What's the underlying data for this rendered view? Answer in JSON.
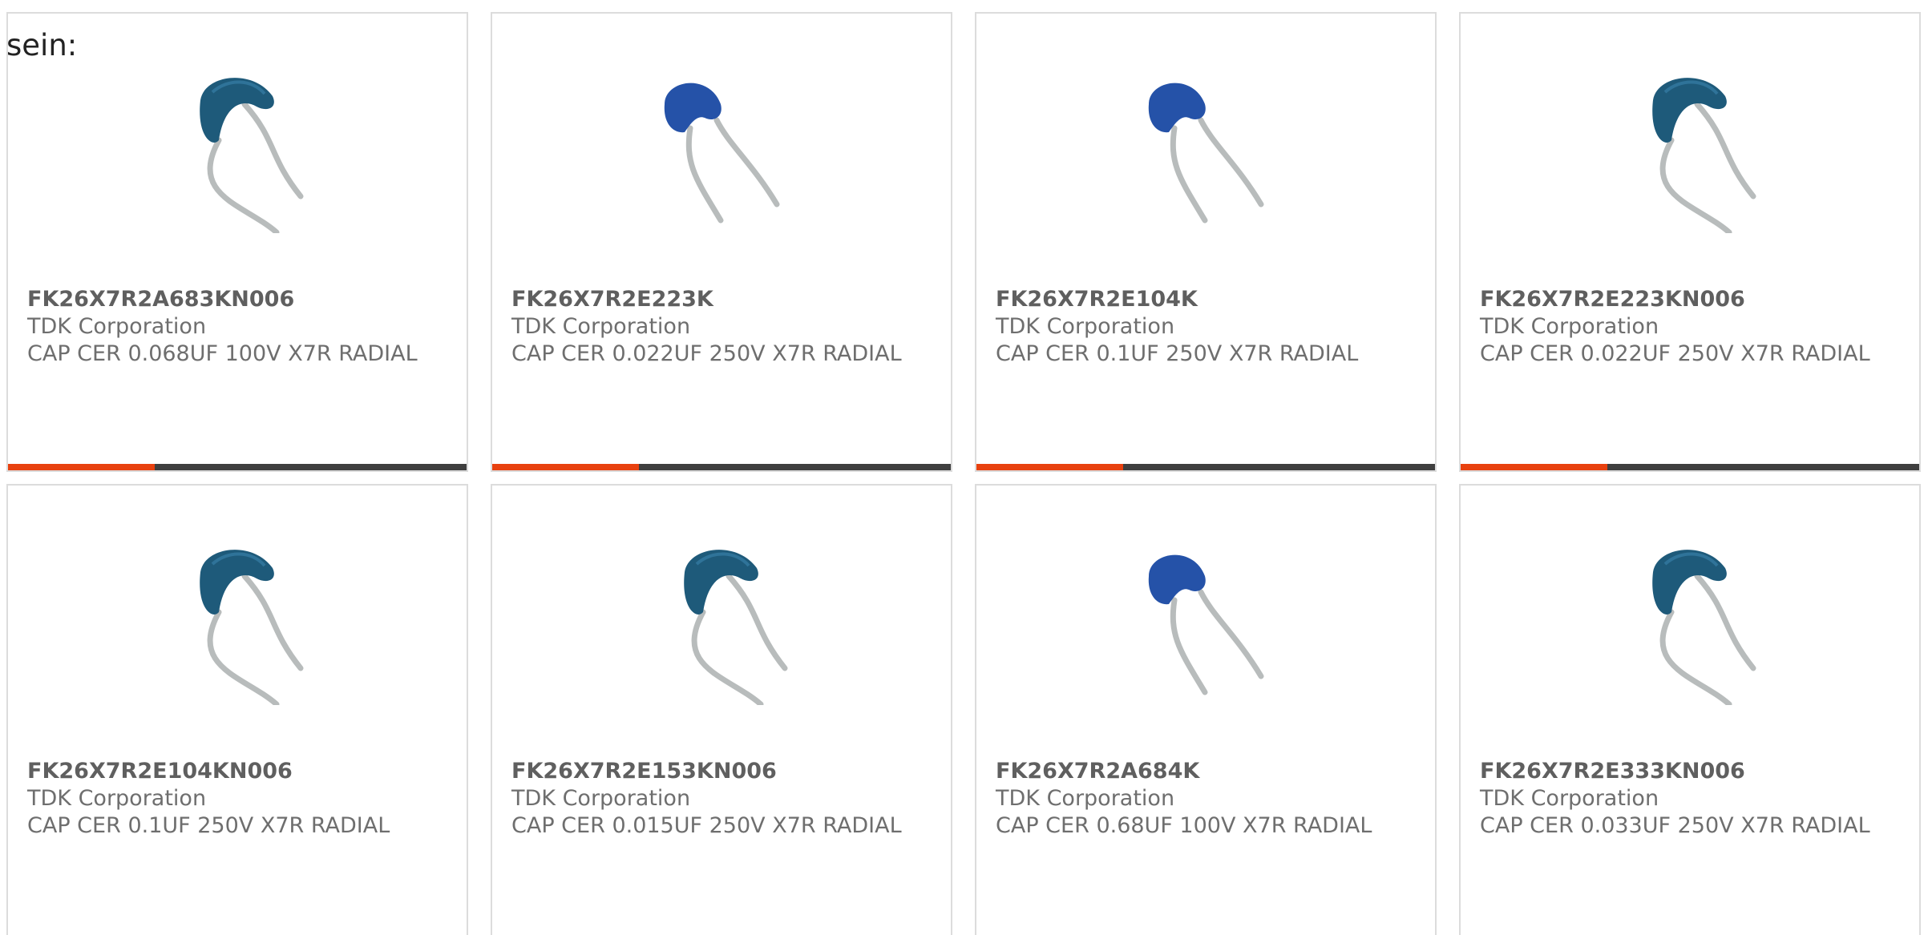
{
  "intro_text": "sein:",
  "colors": {
    "accent": "#e8410f",
    "bar_dark": "#3f3f3f",
    "card_border": "#dcdcdc",
    "text_gray": "#6e6e6e",
    "cap_wide": "#1e5a7a",
    "cap_small": "#2552a8"
  },
  "products": [
    {
      "part": "FK26X7R2A683KN006",
      "manufacturer": "TDK Corporation",
      "description": "CAP CER 0.068UF 100V X7R RADIAL",
      "image": "ceramic-capacitor-wide-icon"
    },
    {
      "part": "FK26X7R2E223K",
      "manufacturer": "TDK Corporation",
      "description": "CAP CER 0.022UF 250V X7R RADIAL",
      "image": "ceramic-capacitor-small-icon"
    },
    {
      "part": "FK26X7R2E104K",
      "manufacturer": "TDK Corporation",
      "description": "CAP CER 0.1UF 250V X7R RADIAL",
      "image": "ceramic-capacitor-small-icon"
    },
    {
      "part": "FK26X7R2E223KN006",
      "manufacturer": "TDK Corporation",
      "description": "CAP CER 0.022UF 250V X7R RADIAL",
      "image": "ceramic-capacitor-wide-icon"
    },
    {
      "part": "FK26X7R2E104KN006",
      "manufacturer": "TDK Corporation",
      "description": "CAP CER 0.1UF 250V X7R RADIAL",
      "image": "ceramic-capacitor-wide-icon"
    },
    {
      "part": "FK26X7R2E153KN006",
      "manufacturer": "TDK Corporation",
      "description": "CAP CER 0.015UF 250V X7R RADIAL",
      "image": "ceramic-capacitor-wide-icon"
    },
    {
      "part": "FK26X7R2A684K",
      "manufacturer": "TDK Corporation",
      "description": "CAP CER 0.68UF 100V X7R RADIAL",
      "image": "ceramic-capacitor-small-icon"
    },
    {
      "part": "FK26X7R2E333KN006",
      "manufacturer": "TDK Corporation",
      "description": "CAP CER 0.033UF 250V X7R RADIAL",
      "image": "ceramic-capacitor-wide-icon"
    }
  ]
}
